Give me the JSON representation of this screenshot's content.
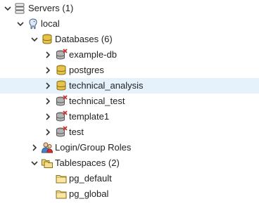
{
  "tree": {
    "servers": {
      "label": "Servers (1)",
      "icon": "servers-icon",
      "expanded": true
    },
    "server_local": {
      "label": "local",
      "icon": "postgres-elephant-icon",
      "expanded": true
    },
    "databases": {
      "label": "Databases (6)",
      "icon": "databases-icon",
      "expanded": true
    },
    "db_example": {
      "label": "example-db",
      "icon": "database-disconnected-icon"
    },
    "db_postgres": {
      "label": "postgres",
      "icon": "database-icon"
    },
    "db_technical_analysis": {
      "label": "technical_analysis",
      "icon": "database-icon",
      "selected": true
    },
    "db_technical_test": {
      "label": "technical_test",
      "icon": "database-disconnected-icon"
    },
    "db_template1": {
      "label": "template1",
      "icon": "database-disconnected-icon"
    },
    "db_test": {
      "label": "test",
      "icon": "database-disconnected-icon"
    },
    "login_roles": {
      "label": "Login/Group Roles",
      "icon": "roles-icon",
      "expanded": false
    },
    "tablespaces": {
      "label": "Tablespaces (2)",
      "icon": "tablespaces-icon",
      "expanded": true
    },
    "ts_default": {
      "label": "pg_default",
      "icon": "folder-icon"
    },
    "ts_global": {
      "label": "pg_global",
      "icon": "folder-icon"
    }
  },
  "colors": {
    "selected_row": "#e5f2fb",
    "db_connected": "#c9a227",
    "db_disconnected": "#8e8e8e",
    "disconnect_mark": "#d0312d",
    "folder": "#f5d76e"
  }
}
